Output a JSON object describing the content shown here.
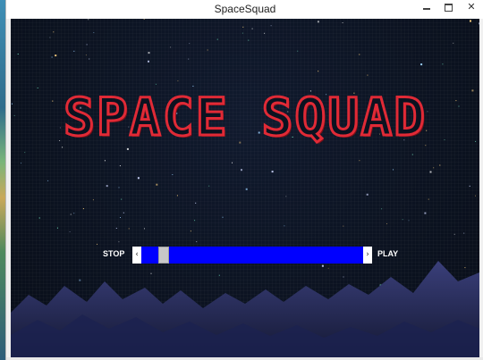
{
  "window": {
    "title": "SpaceSquad",
    "minimize_icon": "minimize-icon",
    "maximize_icon": "maximize-icon",
    "close_glyph": "✕"
  },
  "game": {
    "title": "SPACE SQUAD",
    "title_color": "#e02a36",
    "background_color": "#0b1220",
    "stop_label": "STOP",
    "play_label": "PLAY",
    "slider": {
      "left_arrow": "‹",
      "right_arrow": "›",
      "value_fraction": 0.08,
      "track_color": "#0000ff"
    }
  }
}
